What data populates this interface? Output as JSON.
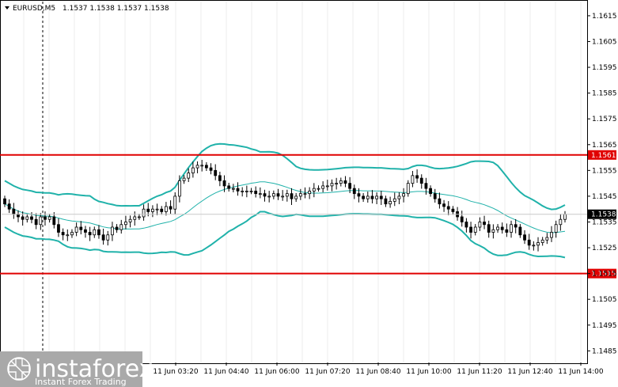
{
  "header": {
    "symbol": "EURUSD,M5",
    "ohlc": "1.1537 1.1538 1.1537 1.1538"
  },
  "watermark": {
    "brand": "instaforex",
    "tagline": "Instant Forex Trading"
  },
  "colors": {
    "candle": "#000000",
    "bands": "#20b2aa",
    "level": "#e00000",
    "grid": "#c0c0c0",
    "price_label_bg": "#000000"
  },
  "chart_data": {
    "type": "candlestick",
    "symbol": "EURUSD",
    "timeframe": "M5",
    "ylim": [
      1.14805,
      1.16205
    ],
    "y_ticks": [
      "1.1615",
      "1.1605",
      "1.1595",
      "1.1585",
      "1.1575",
      "1.1565",
      "1.1555",
      "1.1545",
      "1.1535",
      "1.1525",
      "1.1515",
      "1.1505",
      "1.1495",
      "1.1485"
    ],
    "x_ticks": [
      "11 Jun 03:20",
      "11 Jun 04:40",
      "11 Jun 06:00",
      "11 Jun 07:20",
      "11 Jun 08:40",
      "11 Jun 10:00",
      "11 Jun 11:20",
      "11 Jun 12:40",
      "11 Jun 14:00"
    ],
    "levels": [
      {
        "price": 1.1561,
        "label": "1.1561"
      },
      {
        "price": 1.1515,
        "label": "1.1515"
      }
    ],
    "current_price": {
      "price": 1.1538,
      "label": "1.1538"
    },
    "close": [
      1.1542,
      1.154,
      1.1538,
      1.1537,
      1.1536,
      1.1537,
      1.1536,
      1.1534,
      1.1537,
      1.1536,
      1.1537,
      1.1534,
      1.1531,
      1.153,
      1.153,
      1.1531,
      1.1533,
      1.1532,
      1.1531,
      1.153,
      1.1532,
      1.153,
      1.1528,
      1.153,
      1.1533,
      1.1532,
      1.1534,
      1.1535,
      1.1536,
      1.1537,
      1.1537,
      1.154,
      1.1539,
      1.154,
      1.154,
      1.1539,
      1.1541,
      1.154,
      1.1545,
      1.1551,
      1.1552,
      1.1554,
      1.1556,
      1.1557,
      1.1557,
      1.1556,
      1.1555,
      1.1553,
      1.1551,
      1.1549,
      1.1548,
      1.1548,
      1.1547,
      1.1547,
      1.1547,
      1.1547,
      1.1546,
      1.1546,
      1.1545,
      1.1545,
      1.1546,
      1.1545,
      1.1545,
      1.1546,
      1.1544,
      1.1545,
      1.1546,
      1.1546,
      1.1547,
      1.1548,
      1.1548,
      1.1549,
      1.1549,
      1.155,
      1.155,
      1.1551,
      1.155,
      1.1548,
      1.1546,
      1.1545,
      1.1544,
      1.1545,
      1.1544,
      1.1545,
      1.1544,
      1.1542,
      1.1543,
      1.1544,
      1.1545,
      1.1546,
      1.155,
      1.1553,
      1.1552,
      1.155,
      1.1548,
      1.1546,
      1.1544,
      1.1542,
      1.1541,
      1.154,
      1.1539,
      1.1537,
      1.1535,
      1.1533,
      1.1531,
      1.1533,
      1.1535,
      1.1534,
      1.1531,
      1.1532,
      1.1533,
      1.1532,
      1.1531,
      1.1534,
      1.1533,
      1.153,
      1.1528,
      1.1526,
      1.1526,
      1.1527,
      1.1528,
      1.1529,
      1.1531,
      1.1534,
      1.1536,
      1.1538
    ],
    "y_axis_side": "right",
    "grid": false
  }
}
